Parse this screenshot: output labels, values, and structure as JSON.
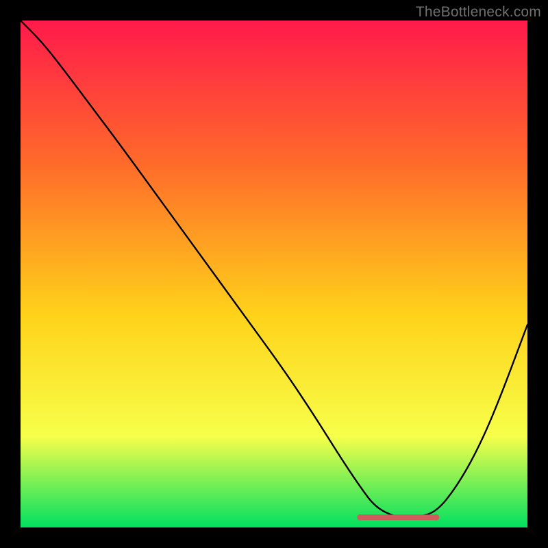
{
  "watermark": "TheBottleneck.com",
  "colors": {
    "background": "#000000",
    "gradient_top": "#ff1a4b",
    "gradient_upper_mid": "#ff6a2a",
    "gradient_mid": "#ffd21a",
    "gradient_lower": "#f7ff4a",
    "gradient_bottom": "#00e060",
    "curve": "#000000",
    "bottom_marker": "#cf5d5d",
    "bottom_marker_dot": "#cf5d5d"
  },
  "chart_data": {
    "type": "line",
    "title": "",
    "xlabel": "",
    "ylabel": "",
    "xlim": [
      0,
      100
    ],
    "ylim": [
      0,
      100
    ],
    "series": [
      {
        "name": "bottleneck-curve",
        "x": [
          0,
          4,
          8,
          14,
          20,
          28,
          36,
          44,
          52,
          58,
          63,
          67,
          70,
          74,
          78,
          82,
          86,
          90,
          94,
          100
        ],
        "y": [
          100,
          96,
          91,
          83,
          75,
          64,
          53,
          42,
          31,
          22,
          14,
          8,
          4,
          2,
          2,
          3,
          8,
          15,
          24,
          40
        ]
      }
    ],
    "flat_segment": {
      "x_start": 67,
      "x_end": 82,
      "y": 2
    }
  }
}
